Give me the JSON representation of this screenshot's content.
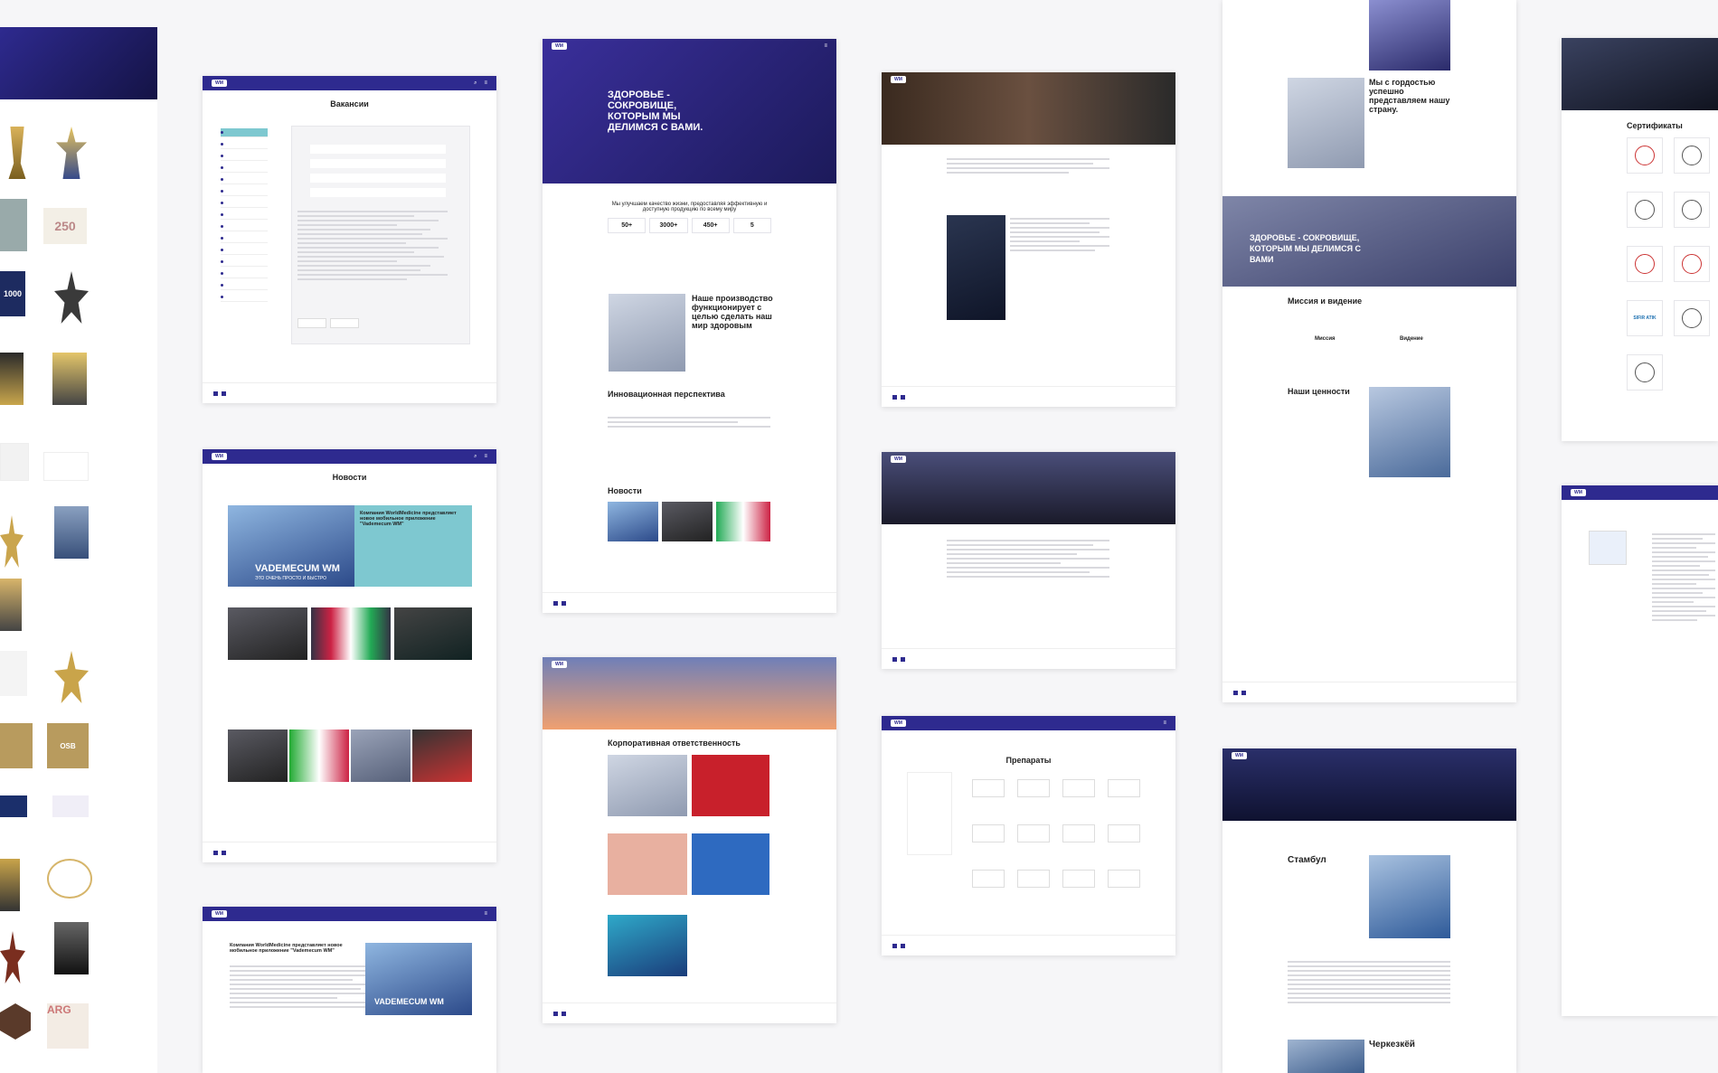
{
  "colors": {
    "brand": "#2e2a8f",
    "accent": "#7ec8d0",
    "background": "#f6f6f8"
  },
  "vacancies": {
    "title": "Вакансии"
  },
  "news_page": {
    "title": "Новости",
    "banner_text": "Компания WorldMedicine представляет новое мобильное приложение \"Vademecum WM\"",
    "banner_label": "VADEMECUM WM",
    "banner_sub": "ЭТО ОЧЕНЬ ПРОСТО И БЫСТРО"
  },
  "home": {
    "hero_title": "ЗДОРОВЬЕ - СОКРОВИЩЕ, КОТОРЫМ МЫ ДЕЛИМСЯ С ВАМИ.",
    "intro": "Мы улучшаем качество жизни, предоставляя эффективную и доступную продукцию по всему миру",
    "stats": [
      {
        "value": "50+"
      },
      {
        "value": "3000+"
      },
      {
        "value": "450+"
      },
      {
        "value": "5"
      }
    ],
    "production_title": "Наше производство функционирует с целью сделать наш мир здоровым",
    "innovation_title": "Инновационная перспектива",
    "news_title": "Новости"
  },
  "csr": {
    "title": "Корпоративная ответственность"
  },
  "products": {
    "title": "Препараты"
  },
  "mission": {
    "title_proud": "Мы с гордостью успешно представляем нашу страну.",
    "hero_text": "ЗДОРОВЬЕ - СОКРОВИЩЕ, КОТОРЫМ МЫ ДЕЛИМСЯ С ВАМИ",
    "mission_vision": "Миссия и видение",
    "mission": "Миссия",
    "vision": "Видение",
    "values": "Наши ценности"
  },
  "production_page": {
    "city1": "Стамбул",
    "city2": "Черкезкёй"
  },
  "certs": {
    "title": "Сертификаты"
  },
  "awards_texts": {
    "a1": "1000",
    "a2": "250",
    "a3": "SIFIR ATIK",
    "a4": "ARG",
    "a5": "OSB"
  }
}
